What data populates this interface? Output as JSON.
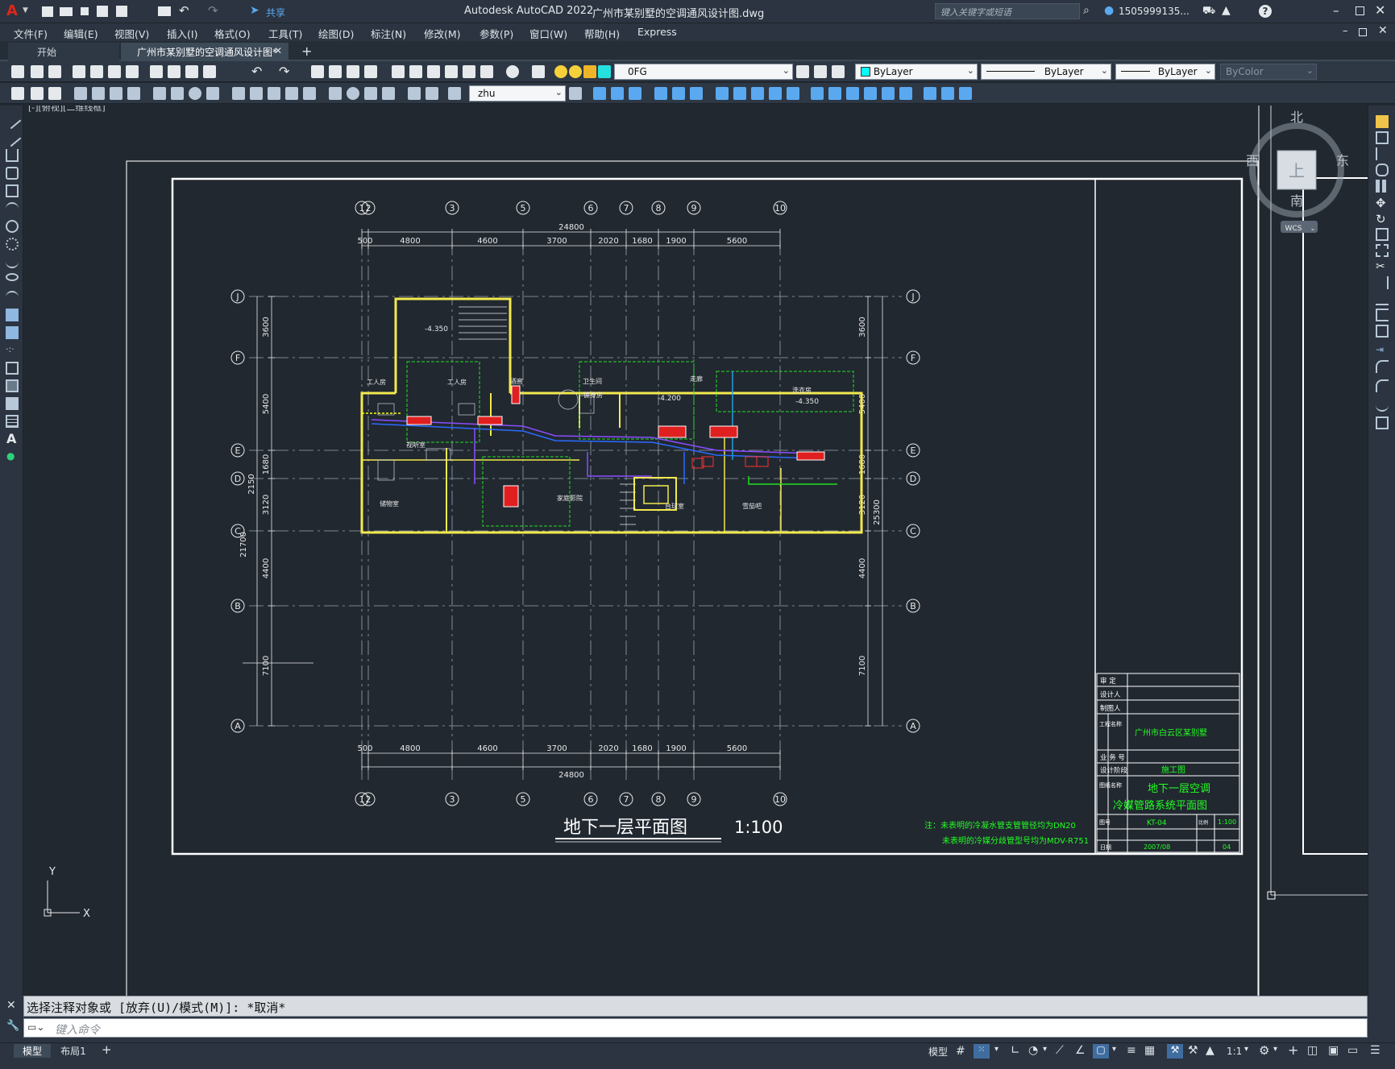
{
  "window": {
    "app_title": "Autodesk AutoCAD 2022",
    "file_title": "广州市某别墅的空调通风设计图.dwg",
    "search_placeholder": "键入关键字或短语",
    "user": "1505999135...",
    "share_label": "共享"
  },
  "menu": [
    "文件(F)",
    "编辑(E)",
    "视图(V)",
    "插入(I)",
    "格式(O)",
    "工具(T)",
    "绘图(D)",
    "标注(N)",
    "修改(M)",
    "参数(P)",
    "窗口(W)",
    "帮助(H)",
    "Express"
  ],
  "tabs": {
    "start": "开始",
    "active": "广州市某别墅的空调通风设计图*"
  },
  "toolbar": {
    "layer": "0FG",
    "color": "ByLayer",
    "linetype": "ByLayer",
    "lineweight": "ByLayer",
    "plotstyle": "ByColor",
    "textstyle": "zhu"
  },
  "viewport": {
    "label": "[-][俯视][二维线框]",
    "viewcube": {
      "north": "北",
      "south": "南",
      "east": "东",
      "west": "西",
      "top": "上",
      "wcs": "WCS"
    }
  },
  "drawing": {
    "title": "地下一层平面图",
    "scale": "1:100",
    "note_line1": "注：未表明的冷凝水管支管管径均为DN20",
    "note_line2": "未表明的冷媒分歧管型号均为MDV-R751",
    "grid_cols_top": [
      "⑴⑵",
      "3",
      "5",
      "6",
      "7",
      "8",
      "9",
      "10"
    ],
    "col_labels": [
      "1",
      "2",
      "3",
      "5",
      "6",
      "7",
      "8",
      "9",
      "10"
    ],
    "row_labels": [
      "J",
      "F",
      "E",
      "D",
      "C",
      "B",
      "A"
    ],
    "dims_top": [
      "500",
      "4800",
      "4600",
      "3700",
      "2020",
      "1680",
      "1900",
      "5600"
    ],
    "total_width": "24800",
    "dims_left": [
      "3600",
      "5400",
      "1680",
      "3120",
      "4400",
      "7100"
    ],
    "dims_left_extra": [
      "2150",
      "21700"
    ],
    "dims_right": [
      "3600",
      "5400",
      "1680",
      "3120",
      "4400",
      "7100"
    ],
    "total_height_right": "25300",
    "title_block": {
      "review": "审 定",
      "designer": "设计人",
      "drafter": "制图人",
      "project_label": "工程名称",
      "project": "广州市白云区某别墅",
      "job_no": "业 务 号",
      "stage_label": "设计阶段",
      "stage": "施工图",
      "drawing_name_label": "图纸名称",
      "drawing_name_1": "地下一层空调",
      "drawing_name_2": "冷媒管路系统平面图",
      "drawing_no_label": "图号",
      "drawing_no": "KT-04",
      "scale_label": "比例",
      "scale": "1:100",
      "date_label": "日期",
      "date": "2007/08",
      "sheet": "04"
    },
    "rooms": [
      "工人房",
      "工人房",
      "视听室",
      "卫生间",
      "健身房",
      "走廊",
      "洗衣房",
      "家庭影院",
      "储物室",
      "台球室",
      "雪茄吧",
      "酒窖"
    ],
    "levels": [
      "-4.350",
      "-4.200",
      "-4.350"
    ]
  },
  "command": {
    "history": "选择注释对象或 [放弃(U)/模式(M)]: *取消*",
    "placeholder": "键入命令"
  },
  "status": {
    "model_tab": "模型",
    "layout_tab": "布局1",
    "model_btn": "模型",
    "scale": "1:1"
  }
}
